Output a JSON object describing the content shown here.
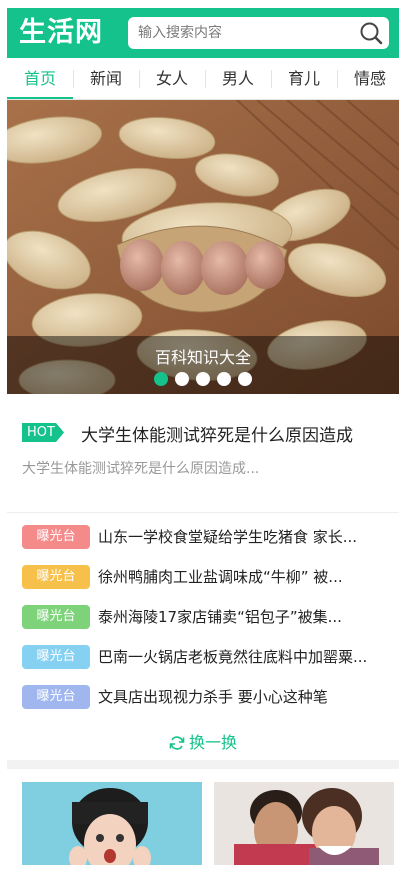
{
  "header": {
    "logo_text": "生活网",
    "search_placeholder": "输入搜索内容",
    "brand_color": "#15c28b"
  },
  "nav": {
    "tabs": [
      {
        "label": "首页",
        "active": true
      },
      {
        "label": "新闻",
        "active": false
      },
      {
        "label": "女人",
        "active": false
      },
      {
        "label": "男人",
        "active": false
      },
      {
        "label": "育儿",
        "active": false
      },
      {
        "label": "情感",
        "active": false
      }
    ]
  },
  "banner": {
    "title": "百科知识大全",
    "image_alt": "peanuts",
    "slide_count": 5,
    "active_slide": 1
  },
  "hot": {
    "badge": "HOT",
    "title": "大学生体能测试猝死是什么原因造成",
    "description": "大学生体能测试猝死是什么原因造成..."
  },
  "news": {
    "items": [
      {
        "tag": "曝光台",
        "tag_color": "#f58a8a",
        "text": "山东一学校食堂疑给学生吃猪食 家长..."
      },
      {
        "tag": "曝光台",
        "tag_color": "#f7c04a",
        "text": "徐州鸭脯肉工业盐调味成“牛柳” 被..."
      },
      {
        "tag": "曝光台",
        "tag_color": "#7ed37a",
        "text": "泰州海陵17家店铺卖“铝包子”被集..."
      },
      {
        "tag": "曝光台",
        "tag_color": "#86d1f2",
        "text": "巴南一火锅店老板竟然往底料中加罂粟..."
      },
      {
        "tag": "曝光台",
        "tag_color": "#9fb6ee",
        "text": "文具店出现视力杀手 要小心这种笔"
      }
    ],
    "refresh_label": "换一换"
  }
}
